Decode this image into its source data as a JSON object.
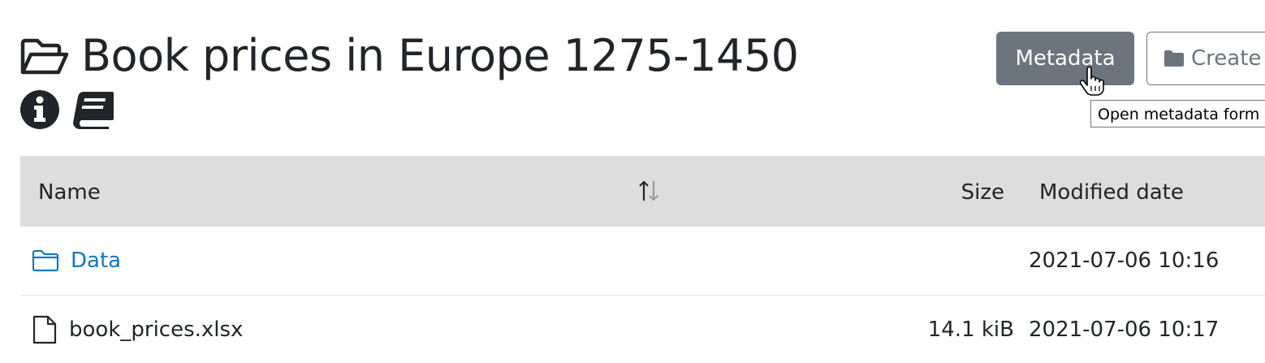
{
  "header": {
    "title": "Book prices in Europe 1275-1450",
    "title_icon": "folder-open-icon",
    "badges": [
      {
        "icon": "info-circle-icon"
      },
      {
        "icon": "book-icon"
      }
    ]
  },
  "toolbar": {
    "metadata_label": "Metadata",
    "create_label": "Create",
    "create_icon": "folder-icon",
    "tooltip": "Open metadata form"
  },
  "table": {
    "columns": {
      "name": "Name",
      "size": "Size",
      "modified": "Modified date"
    },
    "rows": [
      {
        "type": "folder",
        "name": "Data",
        "size": "",
        "modified": "2021-07-06 10:16"
      },
      {
        "type": "file",
        "name": "book_prices.xlsx",
        "size": "14.1 kiB",
        "modified": "2021-07-06 10:17"
      }
    ]
  },
  "colors": {
    "accent_link": "#0d7ac4",
    "secondary_button": "#6c757d",
    "header_bg": "#dddddd"
  }
}
